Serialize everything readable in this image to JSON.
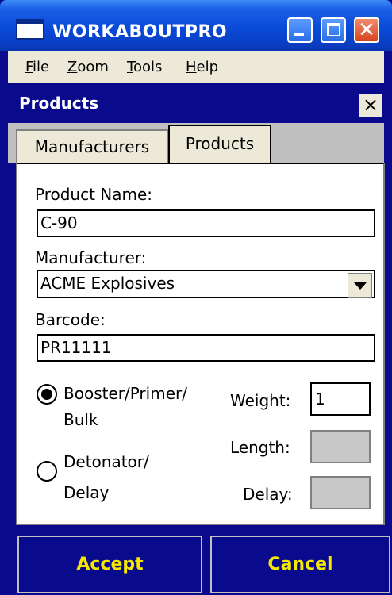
{
  "window": {
    "title": "WORKABOUTPRO"
  },
  "menu": {
    "items": [
      {
        "label": "File",
        "underline": "F",
        "rest": "ile"
      },
      {
        "label": "Zoom",
        "underline": "Z",
        "rest": "oom"
      },
      {
        "label": "Tools",
        "underline": "T",
        "rest": "ools"
      },
      {
        "label": "Help",
        "underline": "H",
        "rest": "elp"
      }
    ]
  },
  "form": {
    "title": "Products",
    "close_glyph": "×"
  },
  "tabs": [
    {
      "label": "Manufacturers",
      "active": false
    },
    {
      "label": "Products",
      "active": true
    }
  ],
  "fields": {
    "product_name": {
      "label": "Product Name:",
      "value": "C-90"
    },
    "manufacturer": {
      "label": "Manufacturer:",
      "value": "ACME Explosives"
    },
    "barcode": {
      "label": "Barcode:",
      "value": "PR11111"
    }
  },
  "type_options": [
    {
      "line1": "Booster/Primer/",
      "line2": "Bulk",
      "selected": true
    },
    {
      "line1": "Detonator/",
      "line2": "Delay",
      "selected": false
    }
  ],
  "measures": {
    "weight": {
      "label": "Weight:",
      "value": "1",
      "enabled": true
    },
    "length": {
      "label": "Length:",
      "value": "",
      "enabled": false
    },
    "delay": {
      "label": "Delay:",
      "value": "",
      "enabled": false
    }
  },
  "buttons": {
    "accept": "Accept",
    "cancel": "Cancel"
  },
  "colors": {
    "title_bar": "#0a4ad8",
    "form_header": "#0a0a8c",
    "button_text": "#f4e800",
    "close_button": "#d8451f"
  },
  "icons": [
    "app-window-icon",
    "minimize-icon",
    "maximize-icon",
    "close-icon",
    "dropdown-arrow-icon"
  ]
}
